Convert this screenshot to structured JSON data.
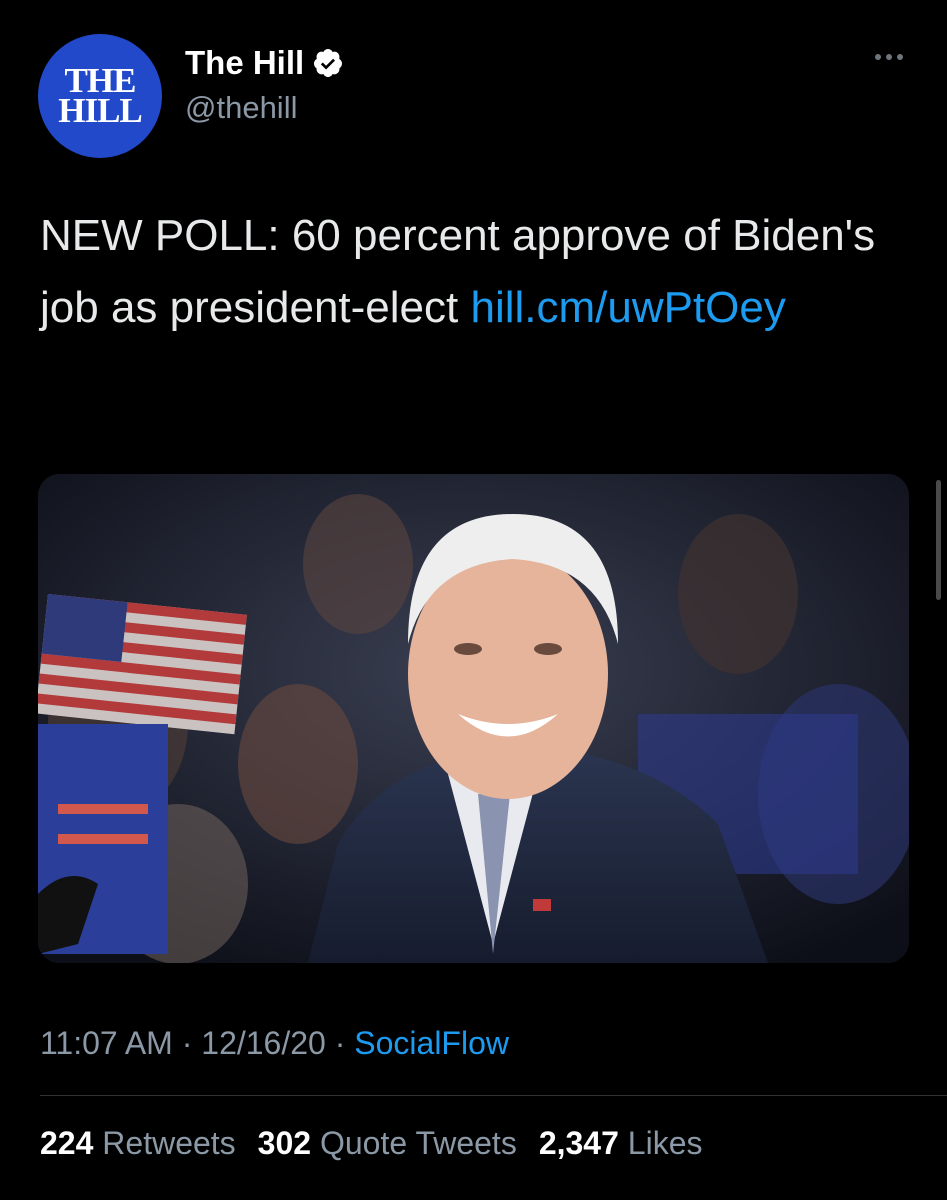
{
  "author": {
    "avatar_text_line1": "THE",
    "avatar_text_line2": "HILL",
    "display_name": "The Hill",
    "handle": "@thehill",
    "verified": true
  },
  "tweet": {
    "text": "NEW POLL: 60 percent approve of Biden's job as president-elect ",
    "link_text": "hill.cm/uwPtOey"
  },
  "media": {
    "description_icon": "photo-icon"
  },
  "meta": {
    "time": "11:07 AM",
    "separator": "·",
    "date": "12/16/20",
    "source": "SocialFlow"
  },
  "stats": {
    "retweets_count": "224",
    "retweets_label": "Retweets",
    "quotes_count": "302",
    "quotes_label": "Quote Tweets",
    "likes_count": "2,347",
    "likes_label": "Likes"
  },
  "colors": {
    "background": "#000000",
    "link": "#1d9bf0",
    "secondary_text": "#8b98a5",
    "avatar_blue": "#2149c9"
  }
}
